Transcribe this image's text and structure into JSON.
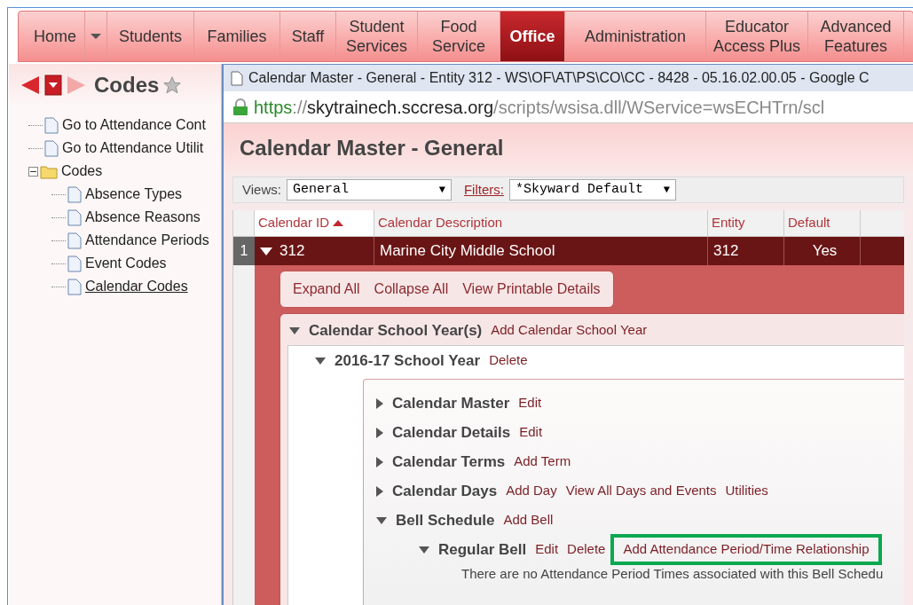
{
  "nav": [
    {
      "label": "Home",
      "selected": false,
      "kind": "tab"
    },
    {
      "selected": false,
      "kind": "caret"
    },
    {
      "label": "Students",
      "selected": false,
      "kind": "tab"
    },
    {
      "label": "Families",
      "selected": false,
      "kind": "tab"
    },
    {
      "label": "Staff",
      "selected": false,
      "kind": "tab"
    },
    {
      "label": "Student Services",
      "selected": false,
      "kind": "tab"
    },
    {
      "label": "Food Service",
      "selected": false,
      "kind": "tab"
    },
    {
      "label": "Office",
      "selected": true,
      "kind": "tab"
    },
    {
      "label": "Administration",
      "selected": false,
      "kind": "tab"
    },
    {
      "label": "Educator Access Plus",
      "selected": false,
      "kind": "tab"
    },
    {
      "label": "Advanced Features",
      "selected": false,
      "kind": "tab"
    }
  ],
  "sidebar": {
    "title": "Codes",
    "items": [
      {
        "label": "Go to Attendance Cont",
        "kind": "page",
        "selected": false
      },
      {
        "label": "Go to Attendance Utilit",
        "kind": "page",
        "selected": false
      },
      {
        "label": "Codes",
        "kind": "folder",
        "expanded": true,
        "selected": false,
        "children": [
          {
            "label": "Absence Types",
            "kind": "page",
            "selected": false
          },
          {
            "label": "Absence Reasons",
            "kind": "page",
            "selected": false
          },
          {
            "label": "Attendance Periods",
            "kind": "page",
            "selected": false
          },
          {
            "label": "Event Codes",
            "kind": "page",
            "selected": false
          },
          {
            "label": "Calendar Codes",
            "kind": "page",
            "selected": true
          }
        ]
      }
    ]
  },
  "popup": {
    "title": "Calendar Master - General - Entity 312 - WS\\OF\\AT\\PS\\CO\\CC - 8428 - 05.16.02.00.05 - Google C",
    "url": {
      "scheme": "https",
      "sep": "://",
      "host": "skytrainech.sccresa.org",
      "path": "/scripts/wsisa.dll/WService=wsECHTrn/scl"
    },
    "page_title": "Calendar Master - General",
    "views": {
      "label": "Views:",
      "value": "General",
      "arrow": "▼"
    },
    "filters": {
      "label": "Filters:",
      "value": "*Skyward Default",
      "arrow": "▼"
    },
    "table": {
      "columns": [
        {
          "label": "Calendar ID",
          "sorted": true
        },
        {
          "label": "Calendar Description",
          "sorted": false
        },
        {
          "label": "Entity",
          "sorted": false
        },
        {
          "label": "Default",
          "sorted": false
        }
      ],
      "rows": [
        {
          "number": "1",
          "expanded": true,
          "cells": [
            "312",
            "Marine City Middle School",
            "312",
            "Yes"
          ]
        }
      ]
    },
    "toolbar": [
      "Expand All",
      "Collapse All",
      "View Printable Details"
    ],
    "sections": [
      {
        "title": "Calendar School Year(s)",
        "expanded": true,
        "actions": [
          "Add Calendar School Year"
        ],
        "children": [
          {
            "title": "2016-17 School Year",
            "expanded": true,
            "actions": [
              "Delete"
            ],
            "children": [
              {
                "title": "Calendar Master",
                "expanded": false,
                "actions": [
                  "Edit"
                ]
              },
              {
                "title": "Calendar Details",
                "expanded": false,
                "actions": [
                  "Edit"
                ]
              },
              {
                "title": "Calendar Terms",
                "expanded": false,
                "actions": [
                  "Add Term"
                ]
              },
              {
                "title": "Calendar Days",
                "expanded": false,
                "actions": [
                  "Add Day",
                  "View All Days and Events",
                  "Utilities"
                ]
              },
              {
                "title": "Bell Schedule",
                "expanded": true,
                "actions": [
                  "Add Bell"
                ],
                "children": [
                  {
                    "title": "Regular Bell",
                    "expanded": true,
                    "actions": [
                      "Edit",
                      "Delete",
                      "Add Attendance Period/Time Relationship"
                    ],
                    "highlighted": [
                      false,
                      false,
                      true
                    ],
                    "message": "There are no Attendance Period Times associated with this Bell Schedu"
                  }
                ]
              }
            ]
          }
        ]
      }
    ]
  }
}
